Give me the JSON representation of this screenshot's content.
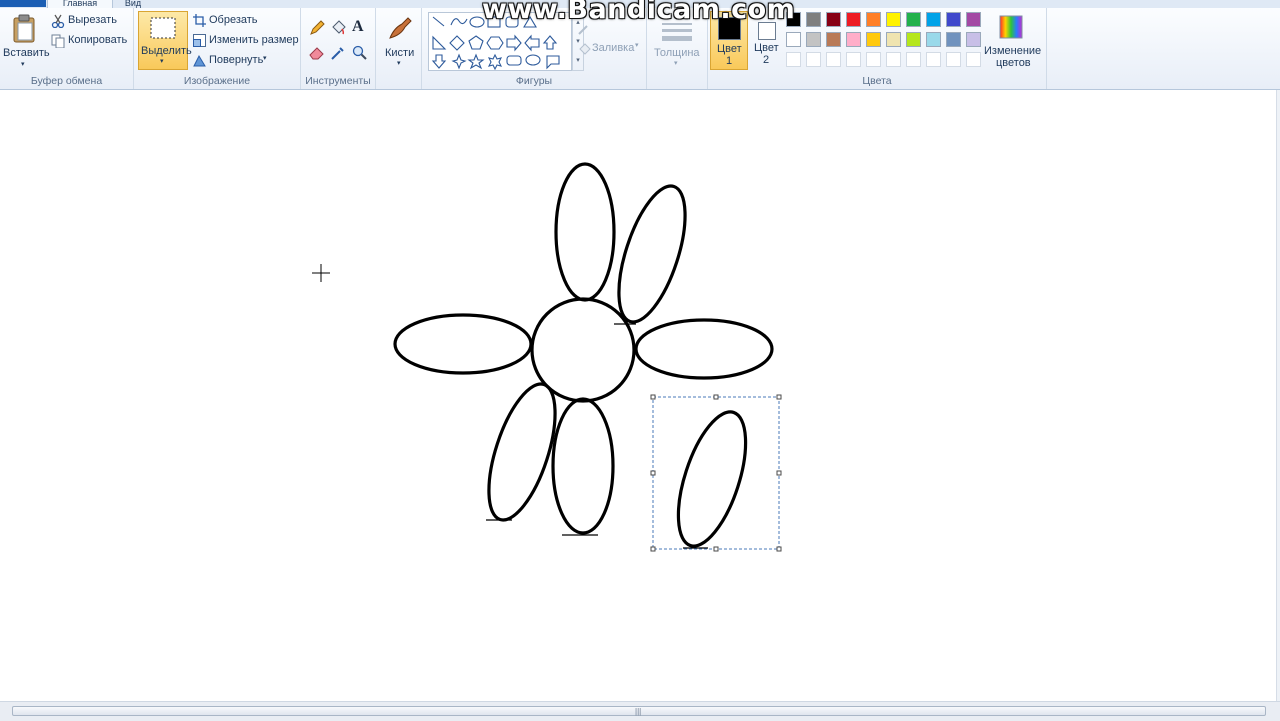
{
  "tabs": {
    "file": "",
    "home": "Главная",
    "view": "Вид"
  },
  "watermark": "www.Bandicam.com",
  "ribbon": {
    "clipboard": {
      "group_label": "Буфер обмена",
      "paste": "Вставить",
      "cut": "Вырезать",
      "copy": "Копировать"
    },
    "image": {
      "group_label": "Изображение",
      "select": "Выделить",
      "crop": "Обрезать",
      "resize": "Изменить размер",
      "rotate": "Повернуть"
    },
    "tools": {
      "group_label": "Инструменты",
      "text_glyph": "A"
    },
    "brushes": {
      "label": "Кисти"
    },
    "shapes": {
      "group_label": "Фигуры",
      "fill": "Заливка",
      "outline": ""
    },
    "size": {
      "label": "Толщина"
    },
    "colors": {
      "group_label": "Цвета",
      "color1_label": "Цвет",
      "color1_num": "1",
      "color2_label": "Цвет",
      "color2_num": "2",
      "edit_colors_line1": "Изменение",
      "edit_colors_line2": "цветов",
      "color1": "#000000",
      "color2": "#ffffff",
      "palette_row1": [
        "#000000",
        "#7f7f7f",
        "#880015",
        "#ed1c24",
        "#ff7f27",
        "#fff200",
        "#22b14c",
        "#00a2e8",
        "#3f48cc",
        "#a349a4"
      ],
      "palette_row2": [
        "#ffffff",
        "#c3c3c3",
        "#b97a57",
        "#ffaec9",
        "#ffc90e",
        "#efe4b0",
        "#b5e61d",
        "#99d9ea",
        "#7092be",
        "#c8bfe7"
      ],
      "palette_row3": [
        "#ffffff",
        "#ffffff",
        "#ffffff",
        "#ffffff",
        "#ffffff",
        "#ffffff",
        "#ffffff",
        "#ffffff",
        "#ffffff",
        "#ffffff"
      ]
    }
  },
  "icons": [
    "paste-icon",
    "scissors-icon",
    "copy-icon",
    "select-icon",
    "crop-icon",
    "resize-icon",
    "rotate-icon",
    "pencil-icon",
    "fill-bucket-icon",
    "text-icon",
    "eraser-icon",
    "color-picker-icon",
    "magnifier-icon",
    "brush-icon",
    "shapes-gallery",
    "size-icon",
    "edit-colors-icon",
    "crosshair-cursor-icon"
  ],
  "canvas": {
    "drawing": "flower-sketch",
    "selection_active": true
  }
}
